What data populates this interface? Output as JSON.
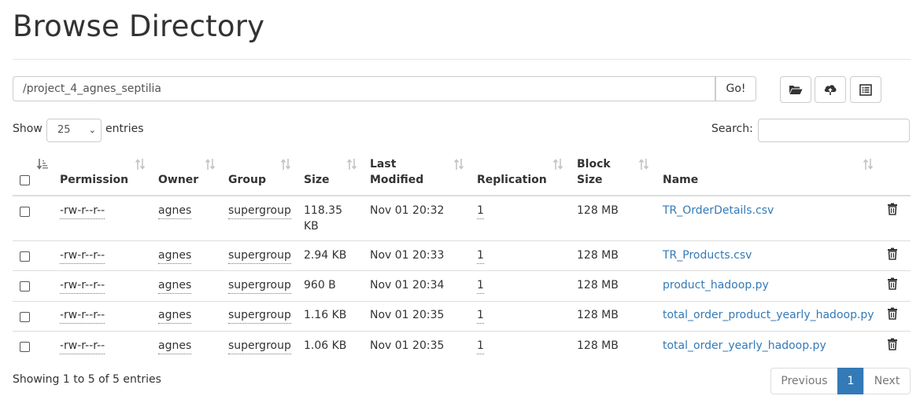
{
  "page": {
    "title": "Browse Directory"
  },
  "path": {
    "value": "/project_4_agnes_septilia",
    "go_label": "Go!"
  },
  "toolbar": {
    "icons": [
      "folder-open-icon",
      "cloud-upload-icon",
      "list-alt-icon"
    ]
  },
  "length_menu": {
    "show_label": "Show",
    "selected": "25",
    "entries_label": "entries"
  },
  "search": {
    "label": "Search:",
    "value": ""
  },
  "table": {
    "headers": {
      "permission": "Permission",
      "owner": "Owner",
      "group": "Group",
      "size": "Size",
      "last_modified_1": "Last",
      "last_modified_2": "Modified",
      "replication": "Replication",
      "block_size_1": "Block",
      "block_size_2": "Size",
      "name": "Name"
    },
    "rows": [
      {
        "permission": "-rw-r--r--",
        "owner": "agnes",
        "group": "supergroup",
        "size_1": "118.35",
        "size_2": "KB",
        "modified": "Nov 01 20:32",
        "replication": "1",
        "block_size": "128 MB",
        "name": "TR_OrderDetails.csv"
      },
      {
        "permission": "-rw-r--r--",
        "owner": "agnes",
        "group": "supergroup",
        "size_1": "2.94 KB",
        "size_2": "",
        "modified": "Nov 01 20:33",
        "replication": "1",
        "block_size": "128 MB",
        "name": "TR_Products.csv"
      },
      {
        "permission": "-rw-r--r--",
        "owner": "agnes",
        "group": "supergroup",
        "size_1": "960 B",
        "size_2": "",
        "modified": "Nov 01 20:34",
        "replication": "1",
        "block_size": "128 MB",
        "name": "product_hadoop.py"
      },
      {
        "permission": "-rw-r--r--",
        "owner": "agnes",
        "group": "supergroup",
        "size_1": "1.16 KB",
        "size_2": "",
        "modified": "Nov 01 20:35",
        "replication": "1",
        "block_size": "128 MB",
        "name": "total_order_product_yearly_hadoop.py"
      },
      {
        "permission": "-rw-r--r--",
        "owner": "agnes",
        "group": "supergroup",
        "size_1": "1.06 KB",
        "size_2": "",
        "modified": "Nov 01 20:35",
        "replication": "1",
        "block_size": "128 MB",
        "name": "total_order_yearly_hadoop.py"
      }
    ]
  },
  "footer": {
    "info": "Showing 1 to 5 of 5 entries",
    "prev_label": "Previous",
    "current_page": "1",
    "next_label": "Next"
  },
  "colors": {
    "link": "#337ab7",
    "pager_active": "#337ab7",
    "border": "#cccccc"
  }
}
